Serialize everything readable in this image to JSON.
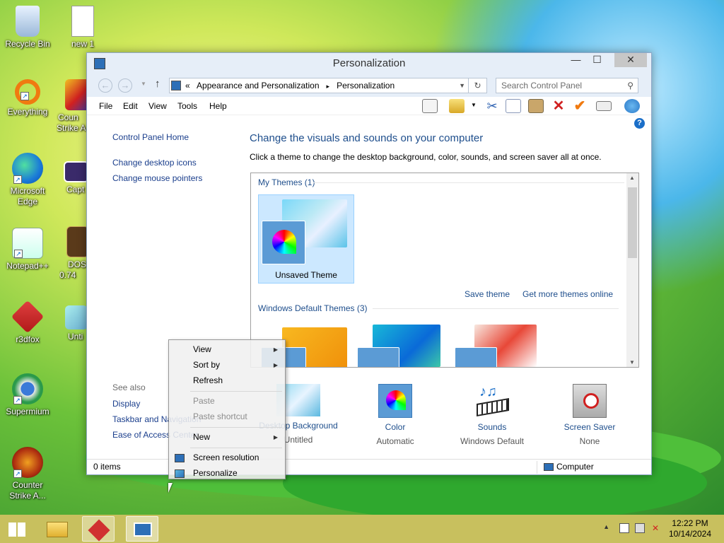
{
  "desktop": {
    "icons": [
      {
        "label": "Recycle Bin",
        "icon": "recycle-bin-icon"
      },
      {
        "label": "new 1",
        "icon": "text-file-icon"
      },
      {
        "label": "Everything",
        "icon": "everything-icon"
      },
      {
        "label": "Coun Strike A",
        "icon": "counter-strike-icon"
      },
      {
        "label": "Microsoft Edge",
        "icon": "edge-icon"
      },
      {
        "label": "Capt",
        "icon": "capture-icon"
      },
      {
        "label": "Notepad++",
        "icon": "notepadpp-icon"
      },
      {
        "label": "DOS 0.74",
        "icon": "dosbox-icon"
      },
      {
        "label": "r3dfox",
        "icon": "r3dfox-icon"
      },
      {
        "label": "Unti",
        "icon": "image-icon"
      },
      {
        "label": "Supermium",
        "icon": "supermium-icon"
      },
      {
        "label": "Counter Strike A...",
        "icon": "counter-strike-icon"
      }
    ]
  },
  "window": {
    "title": "Personalization",
    "controls": {
      "minimize": "—",
      "maximize": "☐",
      "close": "✕"
    },
    "address": {
      "sep": "«",
      "crumb1": "Appearance and Personalization",
      "arrow": "▸",
      "crumb2": "Personalization"
    },
    "search_placeholder": "Search Control Panel",
    "menu": [
      "File",
      "Edit",
      "View",
      "Tools",
      "Help"
    ],
    "left_links": {
      "home": "Control Panel Home",
      "icons": "Change desktop icons",
      "pointers": "Change mouse pointers"
    },
    "see_also": {
      "title": "See also",
      "items": [
        "Display",
        "Taskbar and Navigation",
        "Ease of Access Center"
      ]
    },
    "heading": "Change the visuals and sounds on your computer",
    "subheading": "Click a theme to change the desktop background, color, sounds, and screen saver all at once.",
    "my_themes": "My Themes (1)",
    "unsaved_theme": "Unsaved Theme",
    "save_theme": "Save theme",
    "get_more": "Get more themes online",
    "default_themes": "Windows Default Themes (3)",
    "bottom": [
      {
        "label": "Desktop Background",
        "sub": "Untitled"
      },
      {
        "label": "Color",
        "sub": "Automatic"
      },
      {
        "label": "Sounds",
        "sub": "Windows Default"
      },
      {
        "label": "Screen Saver",
        "sub": "None"
      }
    ],
    "status": {
      "items": "0 items",
      "location": "Computer"
    }
  },
  "context_menu": {
    "view": "View",
    "sort": "Sort by",
    "refresh": "Refresh",
    "paste": "Paste",
    "paste_shortcut": "Paste shortcut",
    "new": "New",
    "screen_res": "Screen resolution",
    "personalize": "Personalize"
  },
  "taskbar": {
    "time": "12:22 PM",
    "date": "10/14/2024",
    "tray_arrow": "▲"
  }
}
